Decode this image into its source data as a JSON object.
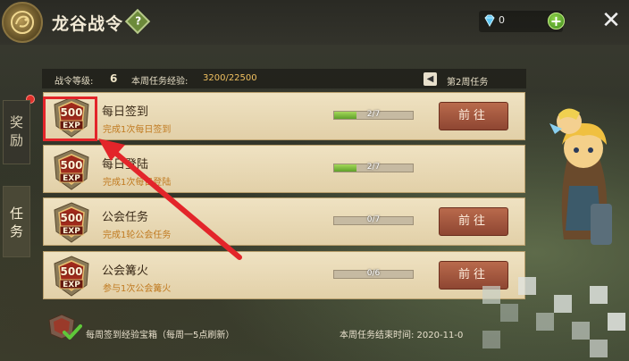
{
  "header": {
    "title": "龙谷战令",
    "help_label": "?",
    "gem_count": "0",
    "plus_label": "+",
    "close_label": "✕"
  },
  "side_tabs": [
    {
      "chars": [
        "奖",
        "励"
      ],
      "active": false
    },
    {
      "chars": [
        "任",
        "务"
      ],
      "active": true
    }
  ],
  "info": {
    "level_label": "战令等级:",
    "level_value": "6",
    "weekly_exp_label": "本周任务经验:",
    "weekly_exp_value": "3200/22500",
    "week_nav_icon": "◀",
    "week_label": "第2周任务"
  },
  "tasks": [
    {
      "exp": "500",
      "exp_unit": "EXP",
      "name": "每日签到",
      "desc": "完成1次每日签到",
      "progress": "2/7",
      "progress_ratio": 0.2857,
      "button": "前往"
    },
    {
      "exp": "500",
      "exp_unit": "EXP",
      "name": "每日登陆",
      "desc": "完成1次每日登陆",
      "progress": "2/7",
      "progress_ratio": 0.2857,
      "button": ""
    },
    {
      "exp": "500",
      "exp_unit": "EXP",
      "name": "公会任务",
      "desc": "完成1轮公会任务",
      "progress": "0/7",
      "progress_ratio": 0,
      "button": "前往"
    },
    {
      "exp": "500",
      "exp_unit": "EXP",
      "name": "公会篝火",
      "desc": "参与1次公会篝火",
      "progress": "0/6",
      "progress_ratio": 0,
      "button": "前往"
    }
  ],
  "footer": {
    "chest_text": "每周签到经验宝箱（每周一5点刷新）",
    "end_time_text": "本周任务结束时间:  2020-11-0"
  },
  "colors": {
    "highlight": "#e3252a",
    "progress_fill": "#5fa02a",
    "button": "#8e4632"
  }
}
